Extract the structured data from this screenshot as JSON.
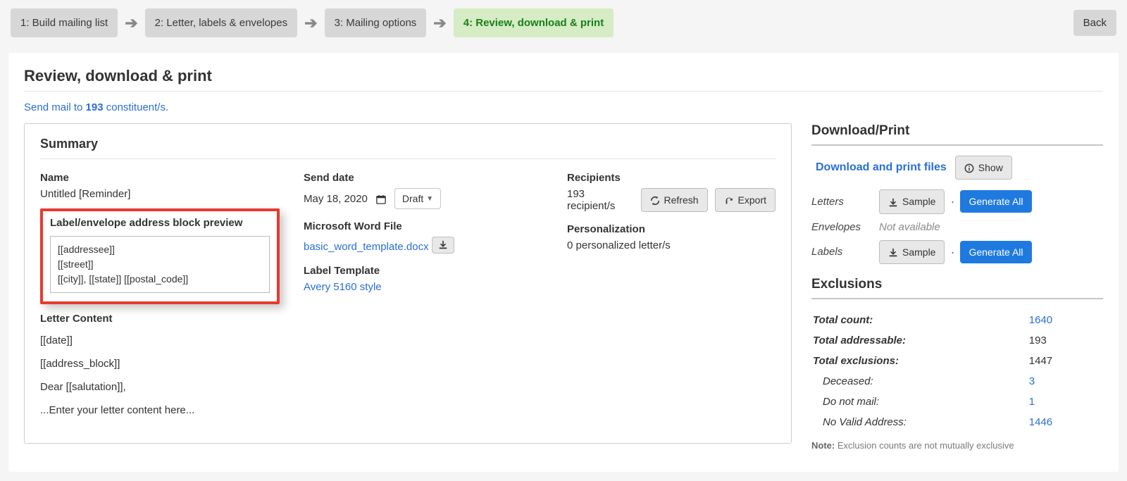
{
  "steps": {
    "s1": "1: Build mailing list",
    "s2": "2: Letter, labels & envelopes",
    "s3": "3: Mailing options",
    "s4": "4: Review, download & print"
  },
  "back_label": "Back",
  "page_title": "Review, download & print",
  "sendmail": {
    "prefix": "Send mail to ",
    "count": "193",
    "suffix": " constituent/s."
  },
  "summary": {
    "heading": "Summary",
    "name_label": "Name",
    "name_value": "Untitled [Reminder]",
    "preview_label": "Label/envelope address block preview",
    "preview_lines": {
      "l1": "[[addressee]]",
      "l2": "[[street]]",
      "l3": "[[city]], [[state]] [[postal_code]]"
    },
    "letter_label": "Letter Content",
    "letter": {
      "l1": "[[date]]",
      "l2": "[[address_block]]",
      "l3": "Dear [[salutation]],",
      "l4": "...Enter your letter content here..."
    },
    "send_date_label": "Send date",
    "send_date_value": "May 18, 2020",
    "draft_label": "Draft",
    "word_label": "Microsoft Word File",
    "word_file": "basic_word_template.docx",
    "label_template_label": "Label Template",
    "label_template_value": "Avery 5160 style",
    "recipients_label": "Recipients",
    "recipients_value": "193 recipient/s",
    "refresh_label": "Refresh",
    "export_label": "Export",
    "personalization_label": "Personalization",
    "personalization_value": "0 personalized letter/s"
  },
  "download": {
    "heading": "Download/Print",
    "link": "Download and print files",
    "show_label": "Show",
    "letters_label": "Letters",
    "envelopes_label": "Envelopes",
    "labels_label": "Labels",
    "sample_label": "Sample",
    "generate_label": "Generate All",
    "not_available": "Not available"
  },
  "exclusions": {
    "heading": "Exclusions",
    "rows": {
      "total_count_label": "Total count:",
      "total_count_value": "1640",
      "total_addressable_label": "Total addressable:",
      "total_addressable_value": "193",
      "total_exclusions_label": "Total exclusions:",
      "total_exclusions_value": "1447",
      "deceased_label": "Deceased:",
      "deceased_value": "3",
      "dnm_label": "Do not mail:",
      "dnm_value": "1",
      "nva_label": "No Valid Address:",
      "nva_value": "1446"
    },
    "note_label": "Note:",
    "note_text": " Exclusion counts are not mutually exclusive"
  }
}
